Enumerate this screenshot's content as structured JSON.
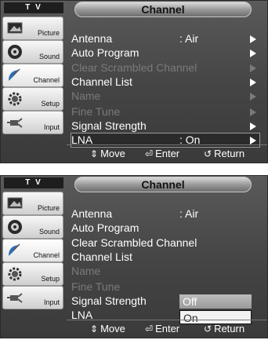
{
  "screens": [
    {
      "tv_label": "T V",
      "title": "Channel",
      "sidebar": [
        {
          "label": "Picture",
          "icon": "picture-icon"
        },
        {
          "label": "Sound",
          "icon": "speaker-icon"
        },
        {
          "label": "Channel",
          "icon": "satellite-dish-icon"
        },
        {
          "label": "Setup",
          "icon": "gear-icon"
        },
        {
          "label": "Input",
          "icon": "plug-icon"
        }
      ],
      "menu": [
        {
          "label": "Antenna",
          "value": ": Air"
        },
        {
          "label": "Auto Program"
        },
        {
          "label": "Clear Scrambled Channel"
        },
        {
          "label": "Channel List"
        },
        {
          "label": "Name"
        },
        {
          "label": "Fine Tune"
        },
        {
          "label": "Signal Strength"
        },
        {
          "label": "LNA",
          "value": ": On"
        }
      ],
      "footer": {
        "move": "Move",
        "enter": "Enter",
        "return": "Return"
      }
    },
    {
      "tv_label": "T V",
      "title": "Channel",
      "sidebar": [
        {
          "label": "Picture",
          "icon": "picture-icon"
        },
        {
          "label": "Sound",
          "icon": "speaker-icon"
        },
        {
          "label": "Channel",
          "icon": "satellite-dish-icon"
        },
        {
          "label": "Setup",
          "icon": "gear-icon"
        },
        {
          "label": "Input",
          "icon": "plug-icon"
        }
      ],
      "menu": [
        {
          "label": "Antenna",
          "value": ": Air"
        },
        {
          "label": "Auto Program"
        },
        {
          "label": "Clear Scrambled Channel"
        },
        {
          "label": "Channel List"
        },
        {
          "label": "Name"
        },
        {
          "label": "Fine Tune"
        },
        {
          "label": "Signal Strength"
        },
        {
          "label": "LNA"
        }
      ],
      "popup": {
        "options": [
          "Off",
          "On"
        ],
        "selected": "On"
      },
      "footer": {
        "move": "Move",
        "enter": "Enter",
        "return": "Return"
      }
    }
  ]
}
